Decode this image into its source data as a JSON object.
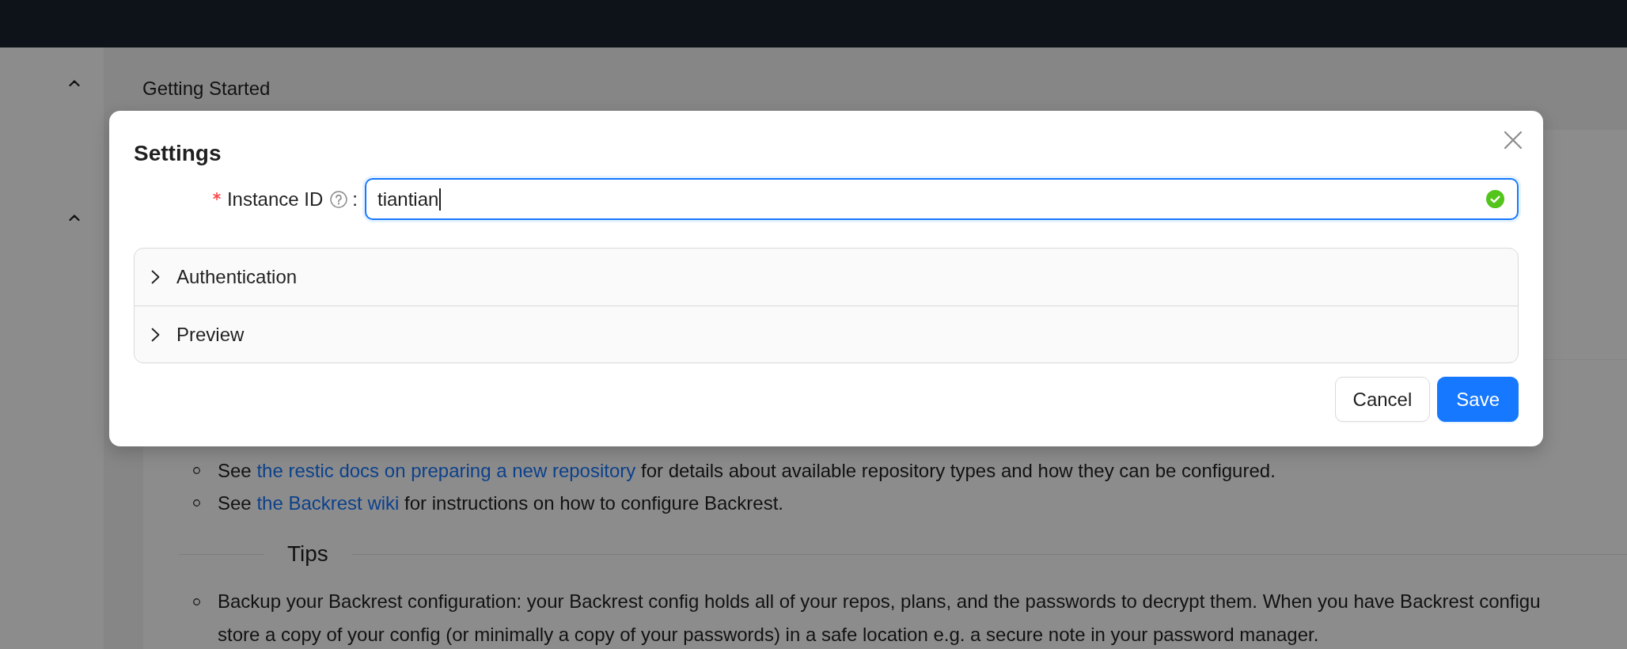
{
  "sidebar": {
    "sections": [
      {
        "expanded": true
      },
      {
        "expanded": true
      }
    ]
  },
  "page": {
    "breadcrumb": "Getting Started",
    "links": [
      {
        "segments": [
          {
            "kind": "text",
            "text": "See "
          },
          {
            "kind": "link",
            "text": "the restic docs on preparing a new repository"
          },
          {
            "kind": "text",
            "text": " for details about available repository types and how they can be configured."
          }
        ]
      },
      {
        "segments": [
          {
            "kind": "text",
            "text": "See "
          },
          {
            "kind": "link",
            "text": "the Backrest wiki"
          },
          {
            "kind": "text",
            "text": " for instructions on how to configure Backrest."
          }
        ]
      }
    ],
    "tips_heading": "Tips",
    "tips": [
      {
        "lines": [
          "Backup your Backrest configuration: your Backrest config holds all of your repos, plans, and the passwords to decrypt them. When you have Backrest configu",
          "store a copy of your config (or minimally a copy of your passwords) in a safe location e.g. a secure note in your password manager."
        ]
      }
    ]
  },
  "modal": {
    "title": "Settings",
    "fields": [
      {
        "label": "Instance ID",
        "required": true,
        "help": true,
        "colon": ":",
        "value": "tiantian",
        "focused": true,
        "valid": true
      }
    ],
    "panels": [
      {
        "label": "Authentication",
        "expanded": false
      },
      {
        "label": "Preview",
        "expanded": false
      }
    ],
    "buttons": [
      {
        "label": "Cancel",
        "kind": "default"
      },
      {
        "label": "Save",
        "kind": "primary"
      }
    ]
  }
}
